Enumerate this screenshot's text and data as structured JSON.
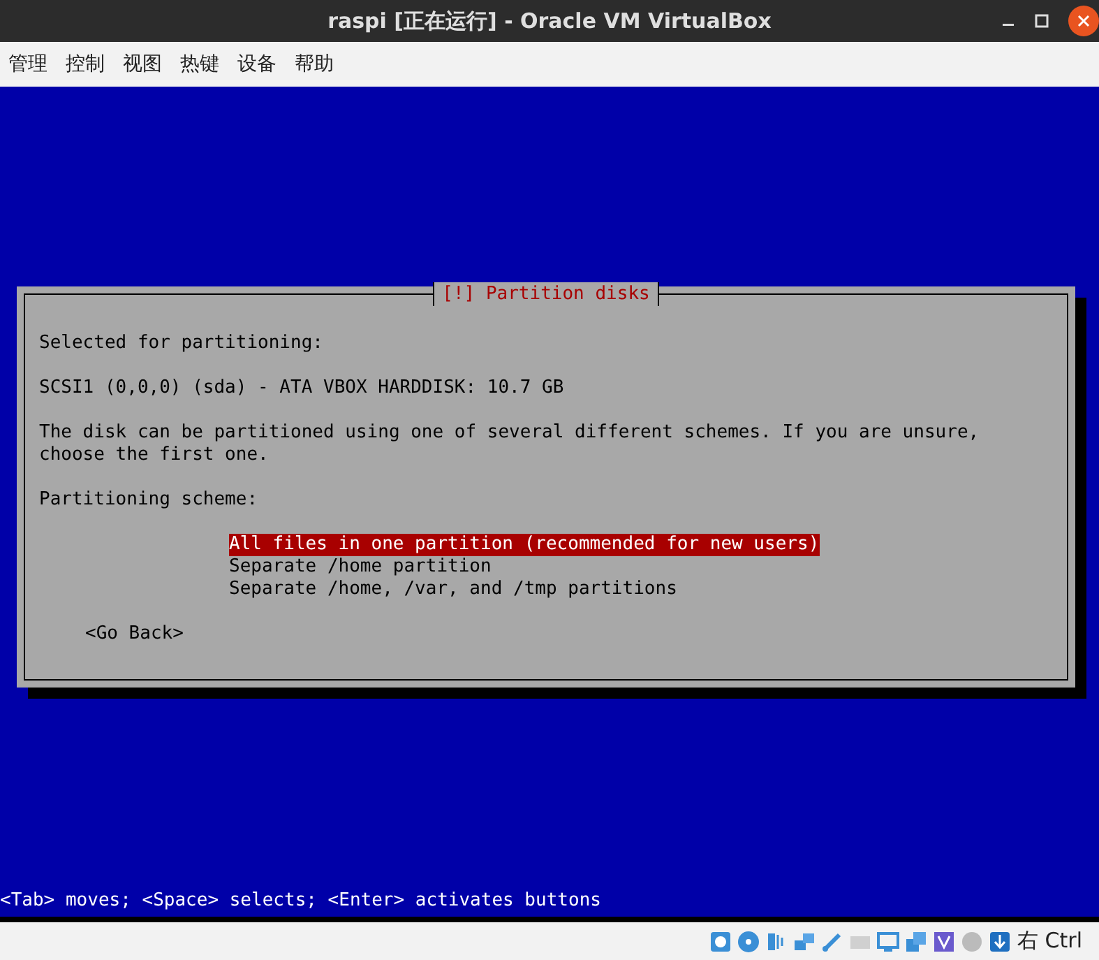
{
  "window": {
    "title": "raspi [正在运行] - Oracle VM VirtualBox"
  },
  "menu": [
    "管理",
    "控制",
    "视图",
    "热键",
    "设备",
    "帮助"
  ],
  "dialog": {
    "title": "[!] Partition disks",
    "paragraphs": [
      "Selected for partitioning:",
      "SCSI1 (0,0,0) (sda) - ATA VBOX HARDDISK: 10.7 GB",
      "The disk can be partitioned using one of several different schemes. If you are unsure, choose the first one.",
      "Partitioning scheme:"
    ],
    "options": [
      {
        "label": "All files in one partition (recommended for new users)",
        "selected": true
      },
      {
        "label": "Separate /home partition",
        "selected": false
      },
      {
        "label": "Separate /home, /var, and /tmp partitions",
        "selected": false
      }
    ],
    "back_button": "<Go Back>"
  },
  "hint": "<Tab> moves; <Space> selects; <Enter> activates buttons",
  "status_bar": {
    "host_key": "右 Ctrl"
  }
}
